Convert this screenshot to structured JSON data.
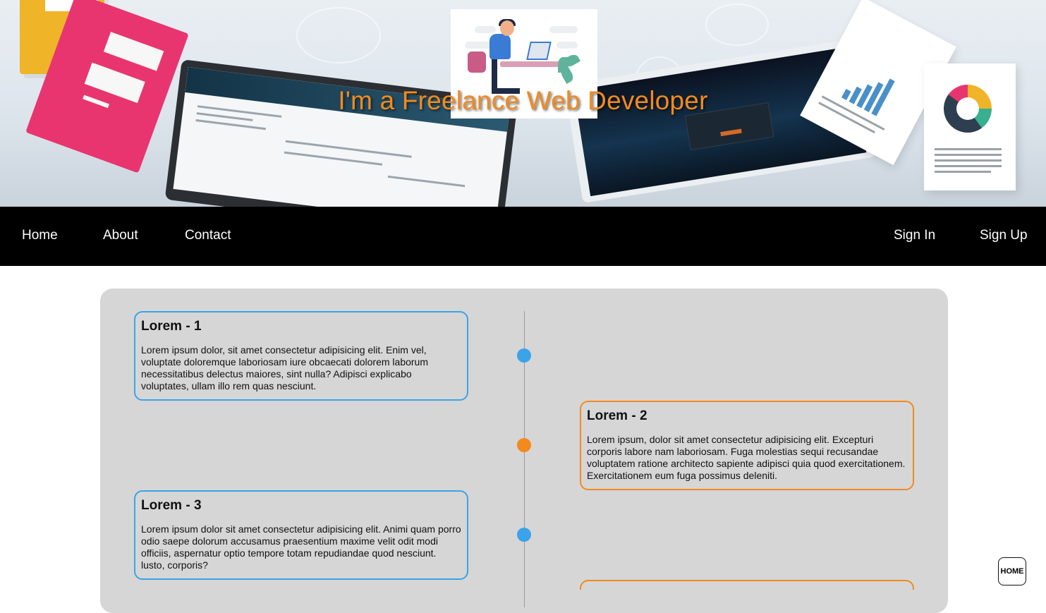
{
  "hero": {
    "title": "I'm a Freelance Web Developer"
  },
  "nav": {
    "left": [
      {
        "label": "Home"
      },
      {
        "label": "About"
      },
      {
        "label": "Contact"
      }
    ],
    "right": [
      {
        "label": "Sign In"
      },
      {
        "label": "Sign Up"
      }
    ]
  },
  "timeline": {
    "colors": {
      "blue": "#3ba3e8",
      "orange": "#f28a1e",
      "panel": "#d6d6d6"
    },
    "items": [
      {
        "title": "Lorem - 1",
        "text": "Lorem ipsum dolor, sit amet consectetur adipisicing elit. Enim vel, voluptate doloremque laboriosam iure obcaecati dolorem laborum necessitatibus delectus maiores, sint nulla? Adipisci explicabo voluptates, ullam illo rem quas nesciunt.",
        "color": "blue"
      },
      {
        "title": "Lorem - 2",
        "text": "Lorem ipsum, dolor sit amet consectetur adipisicing elit. Excepturi corporis labore nam laboriosam. Fuga molestias sequi recusandae voluptatem ratione architecto sapiente adipisci quia quod exercitationem. Exercitationem eum fuga possimus deleniti.",
        "color": "orange"
      },
      {
        "title": "Lorem - 3",
        "text": "Lorem ipsum dolor sit amet consectetur adipisicing elit. Animi quam porro odio saepe dolorum accusamus praesentium maxime velit odit modi officiis, aspernatur optio tempore totam repudiandae quod nesciunt. lusto, corporis?",
        "color": "blue"
      }
    ]
  },
  "home_button": {
    "label": "HOME"
  }
}
